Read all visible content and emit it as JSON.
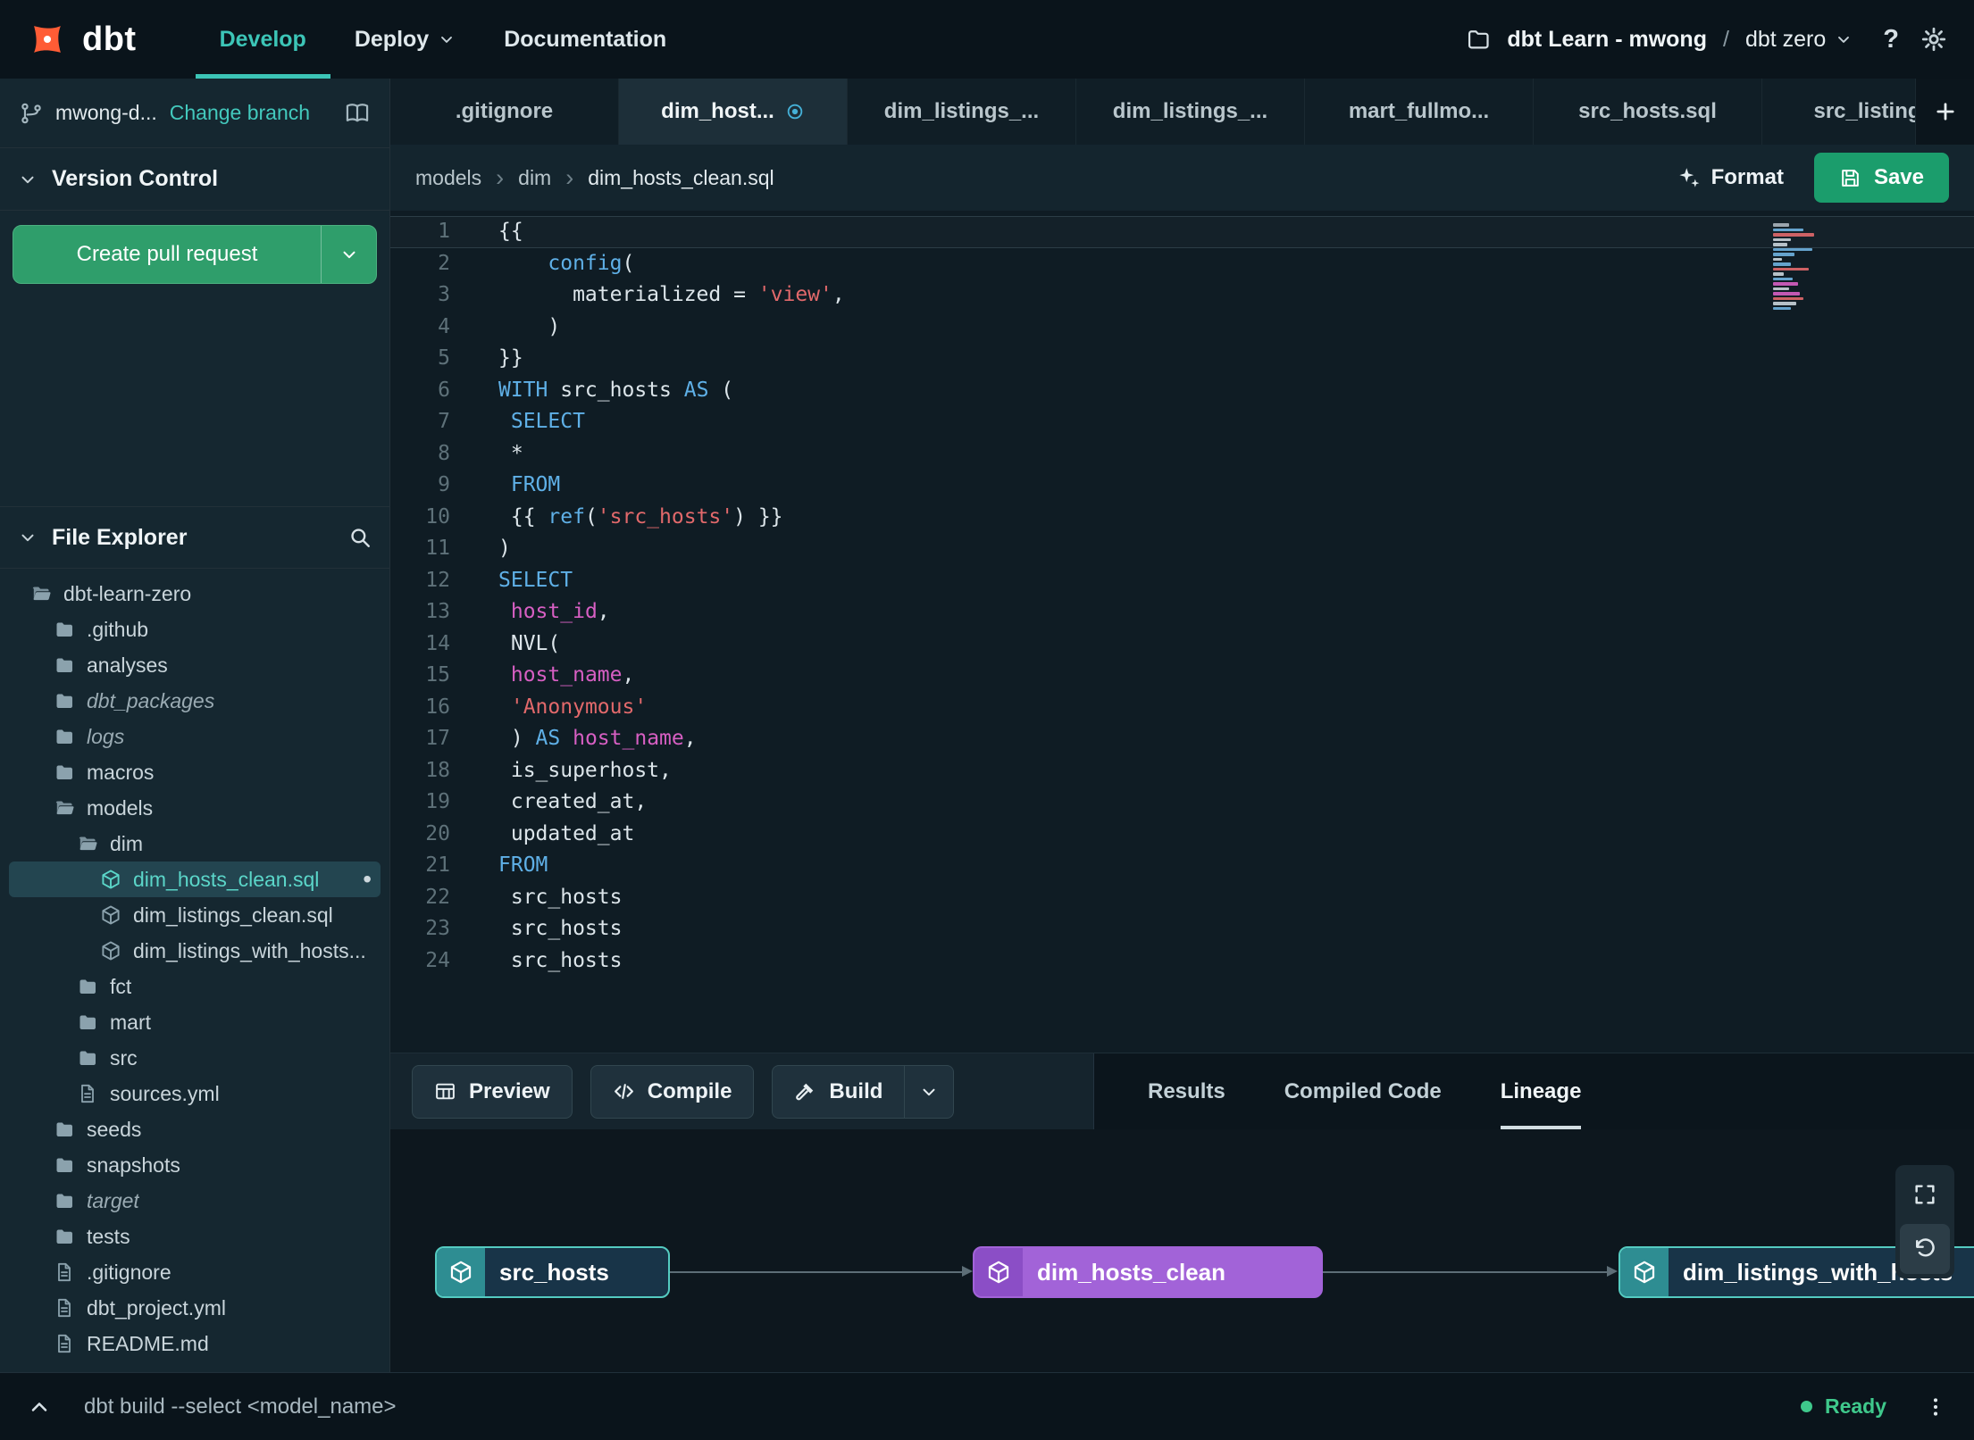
{
  "colors": {
    "accent_teal": "#3cc5b7",
    "accent_green": "#2f9e6b",
    "brand_orange": "#ff5c35",
    "node_purple": "#a263d8",
    "status_green": "#3fc98c"
  },
  "nav": {
    "brand": "dbt",
    "items": [
      {
        "label": "Develop",
        "active": true,
        "chevron": false
      },
      {
        "label": "Deploy",
        "active": false,
        "chevron": true
      },
      {
        "label": "Documentation",
        "active": false,
        "chevron": false
      }
    ],
    "project": "dbt Learn - mwong",
    "separator": "/",
    "environment": "dbt zero",
    "help": "?"
  },
  "sidebar": {
    "branch": "mwong-d...",
    "change_branch": "Change branch",
    "version_control_title": "Version Control",
    "create_pr_label": "Create pull request",
    "file_explorer_title": "File Explorer",
    "tree": [
      {
        "label": "dbt-learn-zero",
        "icon": "folder-open",
        "level": 0
      },
      {
        "label": ".github",
        "icon": "folder",
        "level": 1
      },
      {
        "label": "analyses",
        "icon": "folder",
        "level": 1
      },
      {
        "label": "dbt_packages",
        "icon": "folder",
        "level": 1,
        "italic": true
      },
      {
        "label": "logs",
        "icon": "folder",
        "level": 1,
        "italic": true
      },
      {
        "label": "macros",
        "icon": "folder",
        "level": 1
      },
      {
        "label": "models",
        "icon": "folder-open",
        "level": 1
      },
      {
        "label": "dim",
        "icon": "folder-open",
        "level": 2
      },
      {
        "label": "dim_hosts_clean.sql",
        "icon": "model",
        "level": 3,
        "selected": true,
        "modified": true
      },
      {
        "label": "dim_listings_clean.sql",
        "icon": "model",
        "level": 3
      },
      {
        "label": "dim_listings_with_hosts...",
        "icon": "model",
        "level": 3
      },
      {
        "label": "fct",
        "icon": "folder",
        "level": 2
      },
      {
        "label": "mart",
        "icon": "folder",
        "level": 2
      },
      {
        "label": "src",
        "icon": "folder",
        "level": 2
      },
      {
        "label": "sources.yml",
        "icon": "file",
        "level": 2
      },
      {
        "label": "seeds",
        "icon": "folder",
        "level": 1
      },
      {
        "label": "snapshots",
        "icon": "folder",
        "level": 1
      },
      {
        "label": "target",
        "icon": "folder",
        "level": 1,
        "italic": true
      },
      {
        "label": "tests",
        "icon": "folder",
        "level": 1
      },
      {
        "label": ".gitignore",
        "icon": "file",
        "level": 1
      },
      {
        "label": "dbt_project.yml",
        "icon": "file",
        "level": 1
      },
      {
        "label": "README.md",
        "icon": "file",
        "level": 1
      }
    ]
  },
  "tabbar": {
    "tabs": [
      {
        "label": ".gitignore",
        "active": false
      },
      {
        "label": "dim_host...",
        "active": true
      },
      {
        "label": "dim_listings_...",
        "active": false
      },
      {
        "label": "dim_listings_...",
        "active": false
      },
      {
        "label": "mart_fullmo...",
        "active": false
      },
      {
        "label": "src_hosts.sql",
        "active": false
      },
      {
        "label": "src_listings.",
        "active": false
      }
    ]
  },
  "editor": {
    "breadcrumb": [
      "models",
      "dim",
      "dim_hosts_clean.sql"
    ],
    "format_label": "Format",
    "save_label": "Save",
    "lines": [
      [
        [
          "{{",
          "p"
        ]
      ],
      [
        [
          "    ",
          "p"
        ],
        [
          "config",
          "k"
        ],
        [
          "(",
          "p"
        ]
      ],
      [
        [
          "      materialized = ",
          "p"
        ],
        [
          "'view'",
          "s"
        ],
        [
          ",",
          "p"
        ]
      ],
      [
        [
          "    )",
          "p"
        ]
      ],
      [
        [
          "}}",
          "p"
        ]
      ],
      [
        [
          "WITH",
          "k"
        ],
        [
          " src_hosts ",
          "p"
        ],
        [
          "AS",
          "k"
        ],
        [
          " (",
          "p"
        ]
      ],
      [
        [
          " ",
          "p"
        ],
        [
          "SELECT",
          "k"
        ]
      ],
      [
        [
          " *",
          "p"
        ]
      ],
      [
        [
          " ",
          "p"
        ],
        [
          "FROM",
          "k"
        ]
      ],
      [
        [
          " {{ ",
          "p"
        ],
        [
          "ref",
          "k"
        ],
        [
          "(",
          "p"
        ],
        [
          "'src_hosts'",
          "s"
        ],
        [
          ") }}",
          "p"
        ]
      ],
      [
        [
          ")",
          "p"
        ]
      ],
      [
        [
          "SELECT",
          "k"
        ]
      ],
      [
        [
          " ",
          "p"
        ],
        [
          "host_id",
          "i"
        ],
        [
          ",",
          "p"
        ]
      ],
      [
        [
          " NVL(",
          "p"
        ]
      ],
      [
        [
          " ",
          "p"
        ],
        [
          "host_name",
          "i"
        ],
        [
          ",",
          "p"
        ]
      ],
      [
        [
          " ",
          "p"
        ],
        [
          "'Anonymous'",
          "s"
        ]
      ],
      [
        [
          " ) ",
          "p"
        ],
        [
          "AS",
          "k"
        ],
        [
          " ",
          "p"
        ],
        [
          "host_name",
          "i"
        ],
        [
          ",",
          "p"
        ]
      ],
      [
        [
          " is_superhost,",
          "p"
        ]
      ],
      [
        [
          " created_at,",
          "p"
        ]
      ],
      [
        [
          " updated_at",
          "p"
        ]
      ],
      [
        [
          "FROM",
          "k"
        ]
      ],
      [
        [
          " src_hosts",
          "p"
        ]
      ],
      [
        [
          " src_hosts",
          "p"
        ]
      ],
      [
        [
          " src_hosts",
          "p"
        ]
      ]
    ],
    "minimap": [
      [
        18,
        "#aab4bb"
      ],
      [
        34,
        "#6fb3e0"
      ],
      [
        46,
        "#e2696b"
      ],
      [
        20,
        "#c9d4da"
      ],
      [
        16,
        "#c9d4da"
      ],
      [
        44,
        "#6fb3e0"
      ],
      [
        24,
        "#6fb3e0"
      ],
      [
        10,
        "#c9d4da"
      ],
      [
        20,
        "#6fb3e0"
      ],
      [
        40,
        "#e2696b"
      ],
      [
        12,
        "#c9d4da"
      ],
      [
        22,
        "#6fb3e0"
      ],
      [
        28,
        "#d75fc3"
      ],
      [
        18,
        "#c9d4da"
      ],
      [
        30,
        "#d75fc3"
      ],
      [
        34,
        "#e2696b"
      ],
      [
        26,
        "#c9d4da"
      ],
      [
        20,
        "#6fb3e0"
      ]
    ]
  },
  "panel": {
    "preview_label": "Preview",
    "compile_label": "Compile",
    "build_label": "Build",
    "tabs": [
      {
        "label": "Results",
        "active": false
      },
      {
        "label": "Compiled Code",
        "active": false
      },
      {
        "label": "Lineage",
        "active": true
      }
    ]
  },
  "lineage": {
    "nodes": [
      {
        "label": "src_hosts",
        "style": "teal"
      },
      {
        "label": "dim_hosts_clean",
        "style": "purple"
      },
      {
        "label": "dim_listings_with_hosts",
        "style": "teal"
      }
    ]
  },
  "statusbar": {
    "command": "dbt build --select <model_name>",
    "status": "Ready"
  }
}
